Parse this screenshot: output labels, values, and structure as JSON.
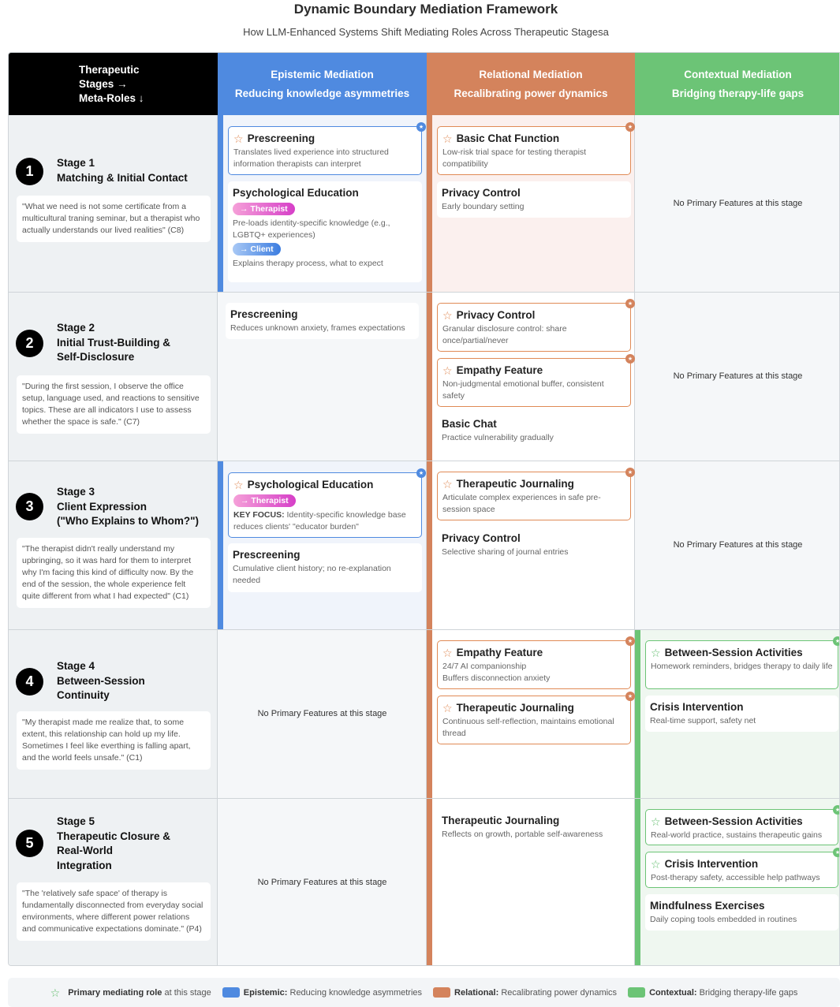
{
  "title": "Dynamic Boundary Mediation Framework",
  "subtitle": "How LLM-Enhanced Systems Shift Mediating Roles Across Therapeutic Stagesa",
  "header": {
    "corner_line1": "Therapeutic",
    "corner_line2": "Stages →",
    "corner_line3": "Meta-Roles ↓",
    "epistemic_title": "Epistemic Mediation",
    "epistemic_sub": "Reducing knowledge asymmetries",
    "relational_title": "Relational Mediation",
    "relational_sub": "Recalibrating power dynamics",
    "contextual_title": "Contextual Mediation",
    "contextual_sub": "Bridging therapy-life gaps"
  },
  "colors": {
    "epistemic": "#4f8ae0",
    "relational": "#d4835c",
    "contextual": "#6cc476"
  },
  "icons": {
    "star": "☆",
    "dot": "★"
  },
  "no_features": "No Primary Features at this stage",
  "stages": [
    {
      "num": "1",
      "label": "Stage 1",
      "name1": "Matching & Initial Contact",
      "name2": "",
      "name3": "",
      "quote": "\"What we need is not some certificate from a multicultural traning seminar, but a therapist who actually understands our lived realities\" (C8)"
    },
    {
      "num": "2",
      "label": "Stage 2",
      "name1": "Initial Trust-Building &",
      "name2": "Self-Disclosure",
      "name3": "",
      "quote": "\"During the first session, I observe the office setup, language used, and reactions to sensitive topics. These are all indicators I use to assess whether the space is safe.\" (C7)"
    },
    {
      "num": "3",
      "label": "Stage 3",
      "name1": "Client Expression",
      "name2": "(\"Who Explains to Whom?\")",
      "name3": "",
      "quote": "\"The therapist didn't really understand my upbringing, so it was hard for them to interpret why I'm facing this kind of difficulty now. By the end of the session, the whole experience felt quite different from what I had expected\" (C1)"
    },
    {
      "num": "4",
      "label": "Stage 4",
      "name1": "Between-Session",
      "name2": "Continuity",
      "name3": "",
      "quote": "\"My therapist made me realize that, to some extent, this relationship can hold up my life. Sometimes I feel like everthing is falling apart, and the world feels unsafe.\" (C1)"
    },
    {
      "num": "5",
      "label": "Stage 5",
      "name1": "Therapeutic Closure &",
      "name2": "Real-World",
      "name3": "Integration",
      "quote": "\"The 'relatively safe space' of therapy is fundamentally disconnected from everyday social environments, where different power relations and communicative expectations dominate.\" (P4)"
    }
  ],
  "cards": {
    "s1_ep_prescreen": {
      "title": "Prescreening",
      "desc": "Translates lived experience into structured information therapists can interpret"
    },
    "s1_ep_psyedu": {
      "title": "Psychological Education",
      "pill1": "→ Therapist",
      "desc1": "Pre-loads identity-specific knowledge (e.g., LGBTQ+ experiences)",
      "pill2": "→ Client",
      "desc2": "Explains therapy process, what to expect"
    },
    "s1_rel_basic": {
      "title": "Basic Chat Function",
      "desc": "Low-risk trial space for testing therapist compatibility"
    },
    "s1_rel_privacy": {
      "title": "Privacy Control",
      "desc": "Early boundary setting"
    },
    "s2_ep_prescreen": {
      "title": "Prescreening",
      "desc": "Reduces unknown anxiety, frames expectations"
    },
    "s2_rel_privacy": {
      "title": "Privacy Control",
      "desc": "Granular disclosure control: share once/partial/never"
    },
    "s2_rel_empathy": {
      "title": "Empathy Feature",
      "desc": "Non-judgmental emotional buffer, consistent safety"
    },
    "s2_rel_basic": {
      "title": "Basic Chat",
      "desc": "Practice vulnerability gradually"
    },
    "s3_ep_psyedu": {
      "title": "Psychological Education",
      "pill": "→ Therapist",
      "key": "KEY FOCUS:",
      "desc": "Identity-specific knowledge base reduces clients' \"educator burden\""
    },
    "s3_ep_prescreen": {
      "title": "Prescreening",
      "desc": "Cumulative client history; no re-explanation needed"
    },
    "s3_rel_journal": {
      "title": "Therapeutic Journaling",
      "desc": "Articulate complex experiences in safe pre-session space"
    },
    "s3_rel_privacy": {
      "title": "Privacy Control",
      "desc": "Selective sharing of journal entries"
    },
    "s4_rel_empathy": {
      "title": "Empathy Feature",
      "desc1": "24/7 AI companionship",
      "desc2": "Buffers disconnection anxiety"
    },
    "s4_rel_journal": {
      "title": "Therapeutic Journaling",
      "desc": "Continuous self-reflection, maintains emotional thread"
    },
    "s4_ctx_between": {
      "title": "Between-Session Activities",
      "desc": "Homework reminders, bridges therapy to daily life"
    },
    "s4_ctx_crisis": {
      "title": "Crisis Intervention",
      "desc": "Real-time support, safety net"
    },
    "s5_rel_journal": {
      "title": "Therapeutic Journaling",
      "desc": "Reflects on growth, portable self-awareness"
    },
    "s5_ctx_between": {
      "title": "Between-Session Activities",
      "desc": "Real-world practice, sustains therapeutic gains"
    },
    "s5_ctx_crisis": {
      "title": "Crisis Intervention",
      "desc": "Post-therapy safety, accessible help pathways"
    },
    "s5_ctx_mind": {
      "title": "Mindfulness Exercises",
      "desc": "Daily coping tools embedded in routines"
    }
  },
  "legend": {
    "primary_bold": "Primary mediating role",
    "primary_rest": "at this stage",
    "ep_bold": "Epistemic:",
    "ep_rest": "Reducing knowledge asymmetries",
    "rel_bold": "Relational:",
    "rel_rest": "Recalibrating power dynamics",
    "ctx_bold": "Contextual:",
    "ctx_rest": "Bridging therapy-life gaps"
  }
}
